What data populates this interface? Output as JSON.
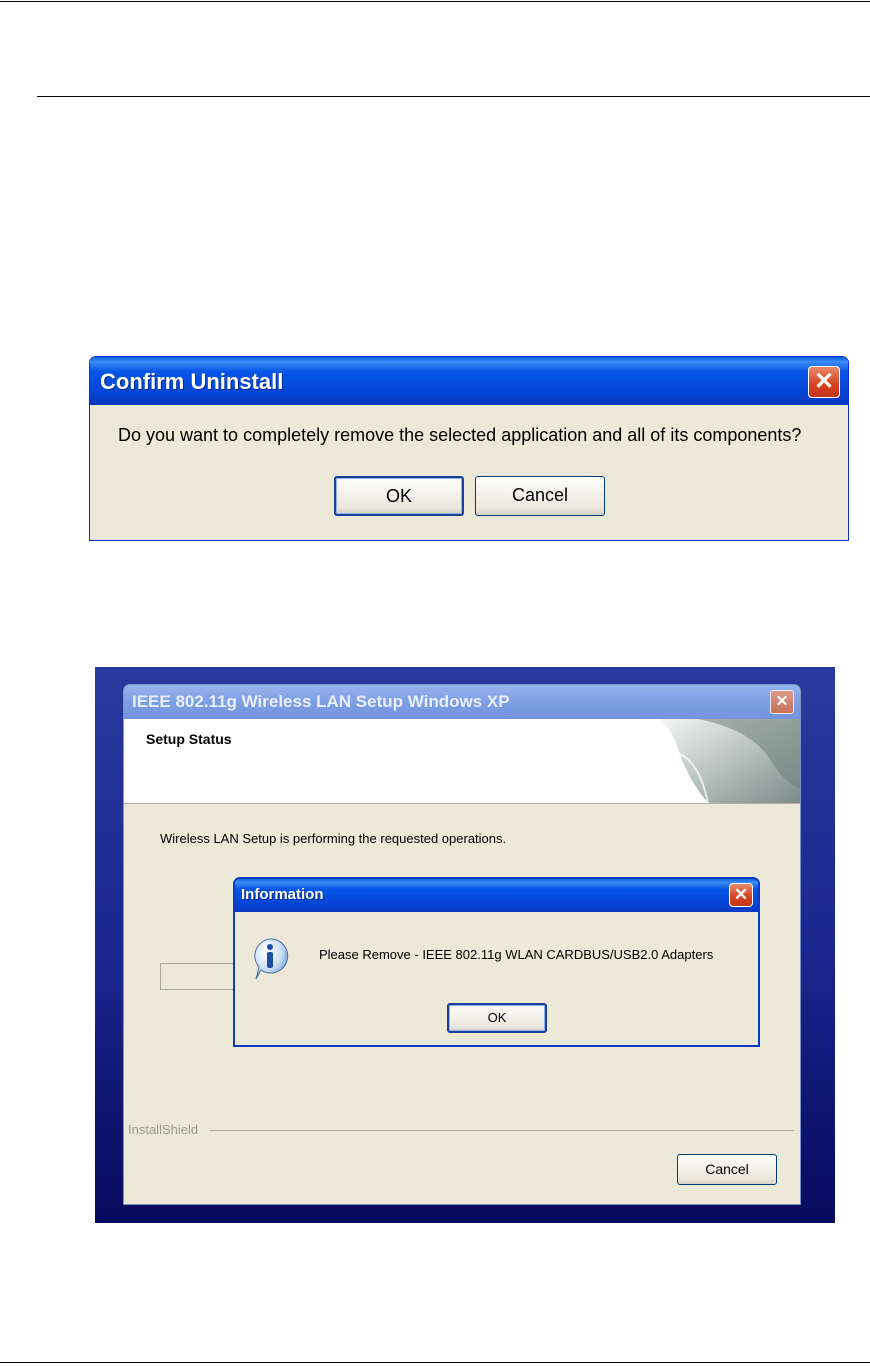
{
  "confirm_dialog": {
    "title": "Confirm Uninstall",
    "message": "Do you want to completely remove the selected application and all of its components?",
    "ok_label": "OK",
    "cancel_label": "Cancel",
    "close_icon": "close-icon",
    "close_symbol": "✕"
  },
  "setup_window": {
    "title": "IEEE 802.11g Wireless LAN Setup Windows XP",
    "header_title": "Setup Status",
    "status_text": "Wireless LAN Setup is performing the requested operations.",
    "footer_label": "InstallShield",
    "cancel_label": "Cancel",
    "close_icon": "close-icon",
    "close_symbol": "✕",
    "background_color": "#1b2790"
  },
  "info_dialog": {
    "title": "Information",
    "message": "Please Remove - IEEE 802.11g WLAN CARDBUS/USB2.0 Adapters",
    "ok_label": "OK",
    "icon": "information-icon",
    "close_icon": "close-icon",
    "close_symbol": "✕"
  },
  "colors": {
    "xp_title_blue": "#0547d8",
    "dialog_face": "#ece9d8",
    "close_red": "#d6421e"
  }
}
